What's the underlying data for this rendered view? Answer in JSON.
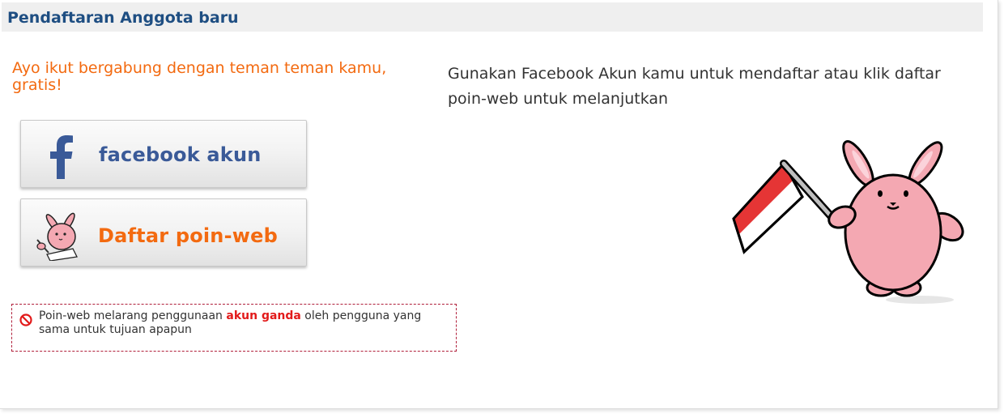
{
  "header": {
    "title": "Pendaftaran Anggota baru"
  },
  "left": {
    "tagline": "Ayo ikut bergabung dengan teman teman kamu, gratis!",
    "facebook_button": {
      "label": "facebook akun",
      "icon": "facebook-f-icon"
    },
    "poinweb_button": {
      "label": "Daftar poin-web",
      "icon": "rabbit-writing-icon"
    }
  },
  "right": {
    "intro": "Gunakan Facebook Akun kamu untuk mendaftar atau klik daftar poin-web untuk melanjutkan"
  },
  "notice": {
    "icon": "prohibited-icon",
    "text_before": "Poin-web melarang penggunaan ",
    "highlight": "akun ganda",
    "text_after": " oleh pengguna yang sama untuk tujuan apapun"
  },
  "colors": {
    "header_title": "#1e4e82",
    "accent_orange": "#f36a10",
    "facebook_blue": "#3a5a98",
    "notice_border": "#b01f3a",
    "highlight_red": "#e21a1a",
    "mascot_pink": "#f4a8b2"
  }
}
